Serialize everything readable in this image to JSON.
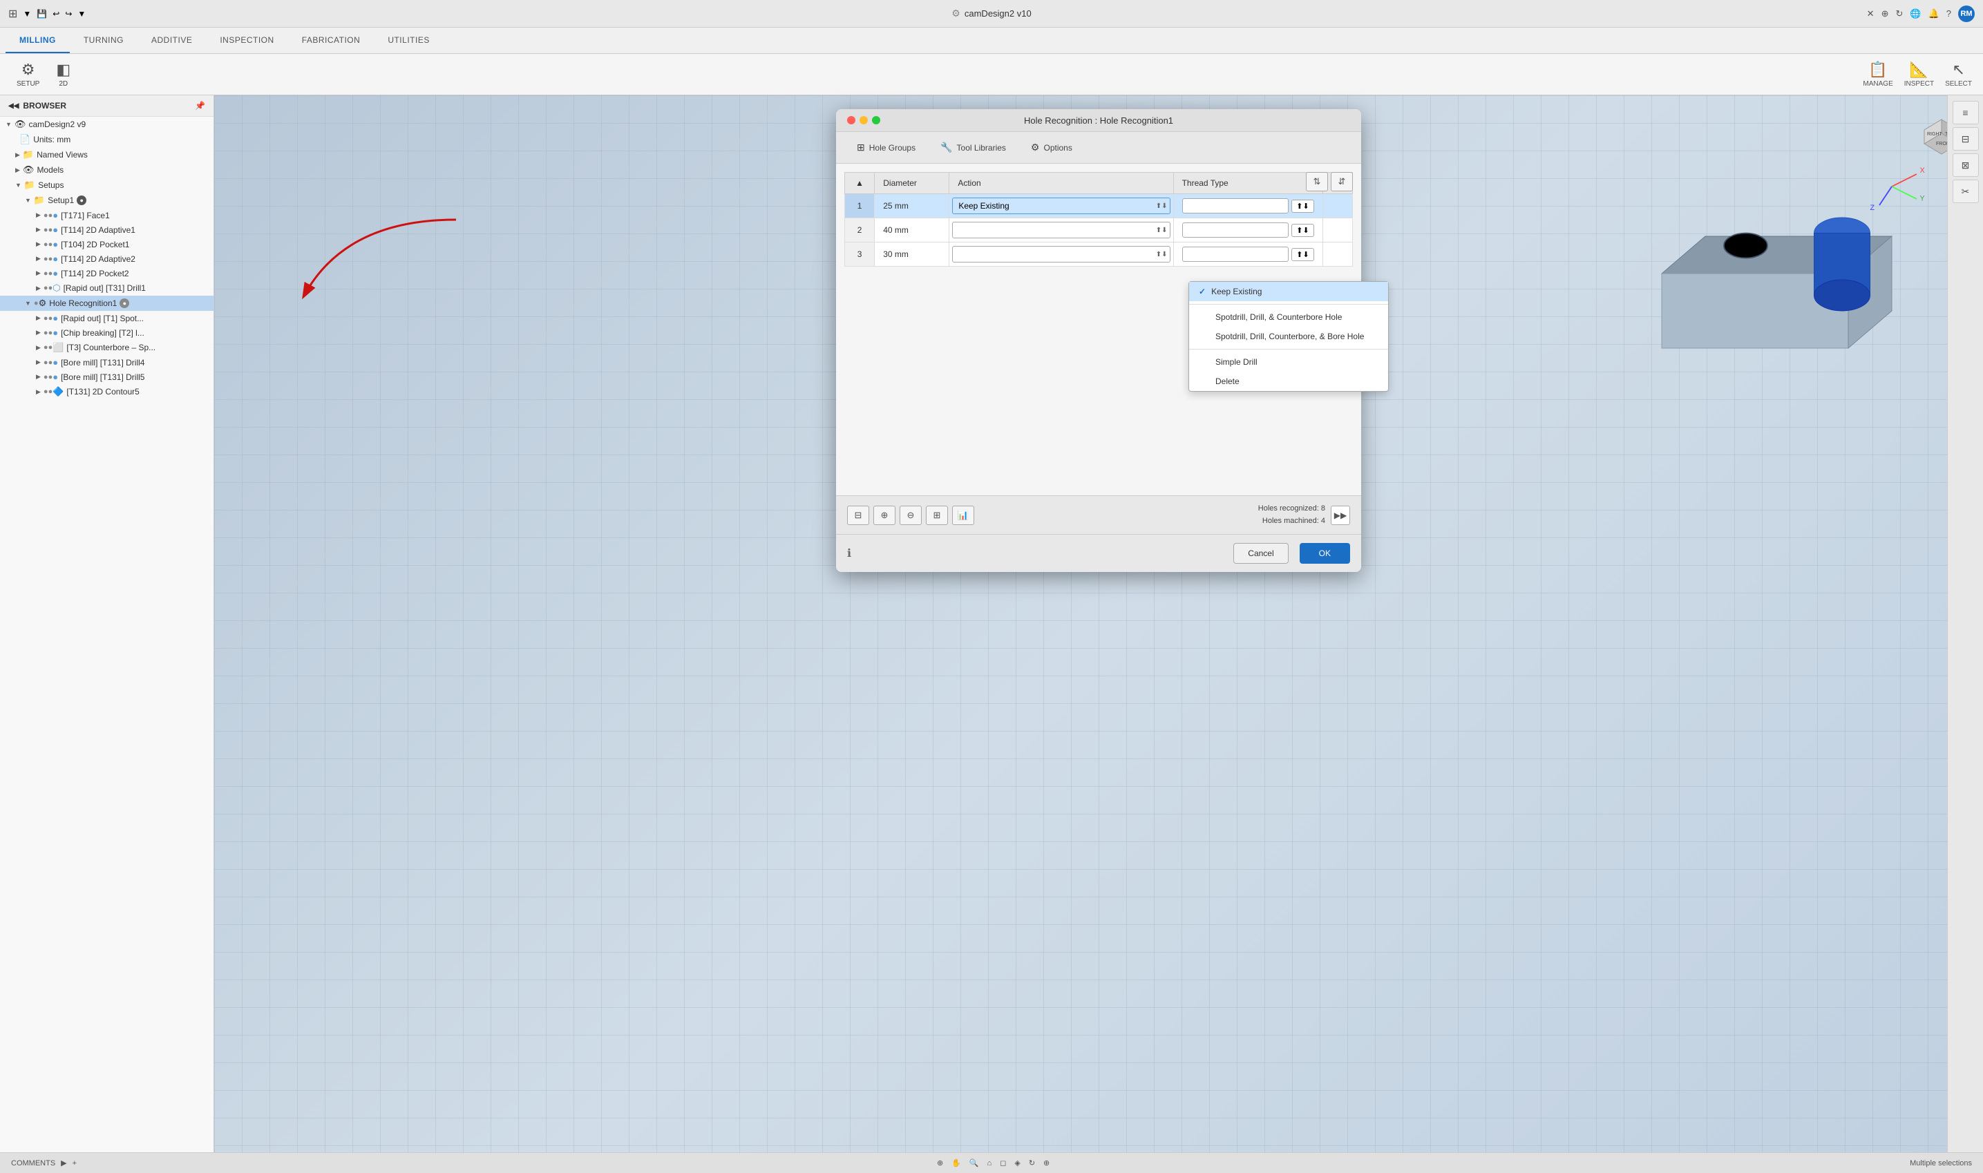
{
  "app": {
    "title": "camDesign2 v10",
    "close_icon": "✕",
    "plus_icon": "⊕"
  },
  "tabs": [
    {
      "label": "MILLING",
      "active": true
    },
    {
      "label": "TURNING",
      "active": false
    },
    {
      "label": "ADDITIVE",
      "active": false
    },
    {
      "label": "INSPECTION",
      "active": false
    },
    {
      "label": "FABRICATION",
      "active": false
    },
    {
      "label": "UTILITIES",
      "active": false
    }
  ],
  "toolbar": {
    "setup_label": "SETUP",
    "setup_icon": "⚙",
    "twoD_label": "2D",
    "twoD_icon": "◧",
    "manage_label": "MANAGE",
    "inspect_label": "INSPECT",
    "select_label": "SELECT"
  },
  "sidebar": {
    "header": "BROWSER",
    "items": [
      {
        "label": "camDesign2 v9",
        "level": 0,
        "has_arrow": true,
        "icon": "📁"
      },
      {
        "label": "Units: mm",
        "level": 1,
        "has_arrow": false,
        "icon": "📄"
      },
      {
        "label": "Named Views",
        "level": 1,
        "has_arrow": true,
        "icon": "📁"
      },
      {
        "label": "Models",
        "level": 1,
        "has_arrow": true,
        "icon": "👁"
      },
      {
        "label": "Setups",
        "level": 1,
        "has_arrow": true,
        "icon": "📁"
      },
      {
        "label": "Setup1",
        "level": 2,
        "has_arrow": true,
        "icon": "⚙",
        "badge": true
      },
      {
        "label": "[T171] Face1",
        "level": 3,
        "has_arrow": true,
        "icon": "🔵"
      },
      {
        "label": "[T114] 2D Adaptive1",
        "level": 3,
        "has_arrow": true,
        "icon": "🔵"
      },
      {
        "label": "[T104] 2D Pocket1",
        "level": 3,
        "has_arrow": true,
        "icon": "🔵"
      },
      {
        "label": "[T114] 2D Adaptive2",
        "level": 3,
        "has_arrow": true,
        "icon": "🔵"
      },
      {
        "label": "[T114] 2D Pocket2",
        "level": 3,
        "has_arrow": true,
        "icon": "🔵"
      },
      {
        "label": "[Rapid out] [T31] Drill1",
        "level": 3,
        "has_arrow": true,
        "icon": "🔵"
      },
      {
        "label": "Hole Recognition1",
        "level": 2,
        "has_arrow": true,
        "icon": "⚙",
        "badge": true,
        "selected": true
      },
      {
        "label": "[Rapid out] [T1] Spot...",
        "level": 3,
        "has_arrow": true,
        "icon": "🔵"
      },
      {
        "label": "[Chip breaking] [T2] l...",
        "level": 3,
        "has_arrow": true,
        "icon": "🔵"
      },
      {
        "label": "[T3] Counterbore – Sp...",
        "level": 3,
        "has_arrow": true,
        "icon": "⬜"
      },
      {
        "label": "[Bore mill] [T131] Drill4",
        "level": 3,
        "has_arrow": true,
        "icon": "🔵"
      },
      {
        "label": "[Bore mill] [T131] Drill5",
        "level": 3,
        "has_arrow": true,
        "icon": "🔵"
      },
      {
        "label": "[T131] 2D Contour5",
        "level": 3,
        "has_arrow": true,
        "icon": "🔷"
      }
    ]
  },
  "dialog": {
    "title": "Hole Recognition : Hole Recognition1",
    "tabs": [
      {
        "label": "Hole Groups",
        "icon": "⊞"
      },
      {
        "label": "Tool Libraries",
        "icon": "🔧"
      },
      {
        "label": "Options",
        "icon": "⚙"
      }
    ],
    "table": {
      "columns": [
        "",
        "Diameter",
        "Action",
        "Thread Type",
        ""
      ],
      "rows": [
        {
          "num": "1",
          "diameter": "25 mm",
          "action": "Keep Existing",
          "thread": "",
          "selected": true
        },
        {
          "num": "2",
          "diameter": "40 mm",
          "action": "",
          "thread": "",
          "selected": false
        },
        {
          "num": "3",
          "diameter": "30 mm",
          "action": "",
          "thread": "",
          "selected": false
        }
      ]
    },
    "dropdown_items": [
      {
        "label": "Keep Existing",
        "selected": true
      },
      {
        "label": "Spotdrill, Drill, & Counterbore Hole",
        "selected": false
      },
      {
        "label": "Spotdrill, Drill, Counterbore, & Bore Hole",
        "selected": false
      },
      {
        "label": "Simple Drill",
        "selected": false
      },
      {
        "label": "Delete",
        "selected": false
      }
    ],
    "footer": {
      "holes_recognized": "Holes recognized: 8",
      "holes_machined": "Holes machined: 4"
    },
    "actions": {
      "info_icon": "ℹ",
      "cancel_label": "Cancel",
      "ok_label": "OK"
    }
  },
  "bottom_bar": {
    "comments": "COMMENTS",
    "status": "Multiple selections"
  }
}
